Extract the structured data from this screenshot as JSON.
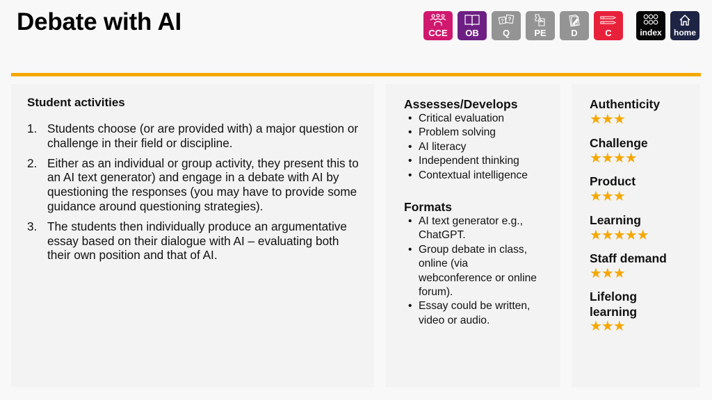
{
  "page": {
    "title": "Debate with AI"
  },
  "nav": [
    {
      "label": "CCE",
      "icon": "people-group-icon",
      "color": "#d1186f"
    },
    {
      "label": "OB",
      "icon": "open-book-icon",
      "color": "#6e1f83"
    },
    {
      "label": "Q",
      "icon": "question-cards-icon",
      "color": "#949494"
    },
    {
      "label": "PE",
      "icon": "puzzle-icon",
      "color": "#949494"
    },
    {
      "label": "D",
      "icon": "document-pencil-icon",
      "color": "#949494"
    },
    {
      "label": "C",
      "icon": "pens-icon",
      "color": "#e8213b"
    },
    {
      "label": "index",
      "icon": "grid-circles-icon",
      "color": "#060606"
    },
    {
      "label": "home",
      "icon": "house-icon",
      "color": "#1e2444"
    }
  ],
  "accent_color": "#f5a800",
  "activities": {
    "heading": "Student activities",
    "items": [
      {
        "num": "1.",
        "text": "Students choose (or are provided with) a major question or challenge in their field or discipline."
      },
      {
        "num": "2.",
        "text": "Either as an individual or group activity, they present this to an AI text generator) and engage in a debate with AI by questioning the responses (you may have to provide some guidance around questioning strategies)."
      },
      {
        "num": "3.",
        "text": "The students then individually produce an argumentative essay based on their dialogue with AI – evaluating both their own position and that of AI."
      }
    ]
  },
  "assesses": {
    "heading": "Assesses/Develops",
    "items": [
      "Critical evaluation",
      "Problem solving",
      "AI literacy",
      "Independent thinking",
      "Contextual intelligence"
    ]
  },
  "formats": {
    "heading": "Formats",
    "items": [
      "AI text generator e.g., ChatGPT.",
      "Group debate in class, online (via webconference or online forum).",
      "Essay could be written, video or audio."
    ]
  },
  "ratings": [
    {
      "label": "Authenticity",
      "stars": 3,
      "display": "★★★"
    },
    {
      "label": "Challenge",
      "stars": 4,
      "display": "★★★★"
    },
    {
      "label": "Product",
      "stars": 3,
      "display": "★★★"
    },
    {
      "label": "Learning",
      "stars": 5,
      "display": "★★★★★"
    },
    {
      "label": "Staff demand",
      "stars": 3,
      "display": "★★★"
    },
    {
      "label": "Lifelong learning",
      "stars": 3,
      "display": "★★★"
    }
  ]
}
